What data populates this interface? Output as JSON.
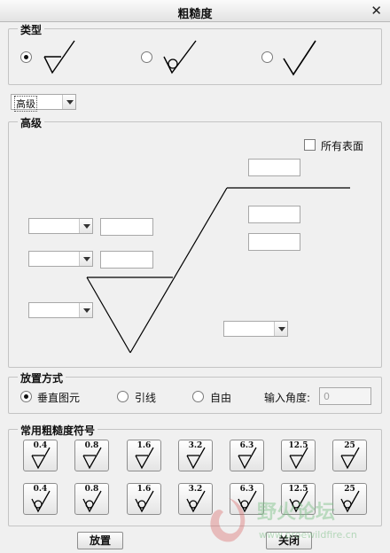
{
  "window": {
    "title": "粗糙度"
  },
  "type_group": {
    "label": "类型",
    "selected_index": 0
  },
  "level_select": {
    "value": "高级"
  },
  "advanced": {
    "label": "高级",
    "all_surfaces_label": "所有表面",
    "all_surfaces_checked": false
  },
  "placement": {
    "label": "放置方式",
    "options": [
      "垂直图元",
      "引线",
      "自由"
    ],
    "selected_index": 0,
    "angle_label": "输入角度:",
    "angle_placeholder": "0"
  },
  "common": {
    "label": "常用粗糙度符号",
    "row1": [
      "0.4",
      "0.8",
      "1.6",
      "3.2",
      "6.3",
      "12.5",
      "25"
    ],
    "row2": [
      "0.4",
      "0.8",
      "1.6",
      "3.2",
      "6.3",
      "12.5",
      "25"
    ]
  },
  "footer": {
    "place_label": "放置",
    "close_label": "关闭"
  },
  "watermark": {
    "text": "野火论坛",
    "url": "www.proewildfire.cn"
  }
}
